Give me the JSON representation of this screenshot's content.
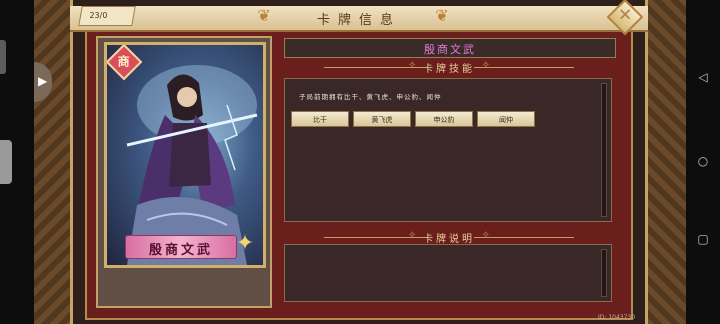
{
  "window": {
    "title": "卡牌信息"
  },
  "counter": {
    "text": "23/0"
  },
  "card": {
    "name": "殷商文武",
    "faction": "商",
    "icons": {
      "faction": "faction-diamond-icon",
      "rarity": "fox-icon"
    }
  },
  "info": {
    "name_bar": "殷商文武",
    "skills_header": "卡牌技能",
    "skills_text": "子局前期拥有比干、黄飞虎、申公豹、闻仲",
    "skill_buttons": [
      "比干",
      "黄飞虎",
      "申公豹",
      "闻仲"
    ],
    "desc_header": "卡牌说明"
  },
  "footer": {
    "id_text": "ID: 1043730"
  },
  "system": {
    "nav_icons": [
      "back-icon",
      "home-icon",
      "recents-icon"
    ]
  },
  "colors": {
    "accent_gold": "#c8a464",
    "panel_red": "#6b1f1c",
    "name_pink": "#e57cd6"
  }
}
